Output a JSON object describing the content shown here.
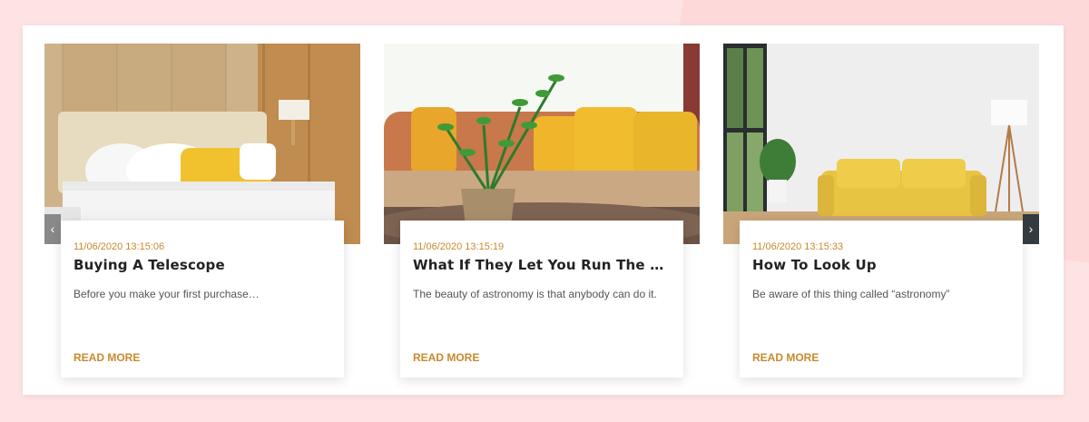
{
  "carousel": {
    "prev_icon": "chevron-left-icon",
    "next_icon": "chevron-right-icon",
    "prev_glyph": "‹",
    "next_glyph": "›"
  },
  "posts": [
    {
      "date": "11/06/2020 13:15:06",
      "title": "Buying A Telescope",
      "excerpt": "Before you make your first purchase…",
      "read_more": "READ MORE",
      "image": "bedroom-photo"
    },
    {
      "date": "11/06/2020 13:15:19",
      "title": "What If They Let You Run The …",
      "excerpt": "The beauty of astronomy is that anybody can do it.",
      "read_more": "READ MORE",
      "image": "living-room-plant-photo"
    },
    {
      "date": "11/06/2020 13:15:33",
      "title": "How To Look Up",
      "excerpt": "Be aware of this thing called “astronomy”",
      "read_more": "READ MORE",
      "image": "yellow-sofa-photo"
    }
  ],
  "colors": {
    "accent": "#c9892e",
    "background": "#fde3e3"
  }
}
